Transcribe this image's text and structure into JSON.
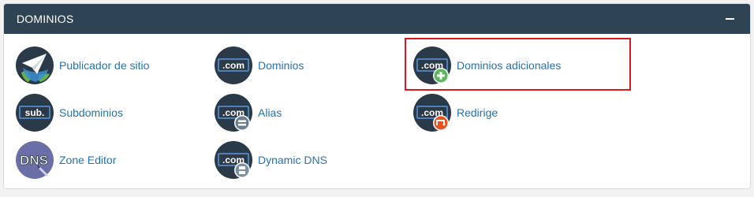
{
  "panel": {
    "title": "DOMINIOS",
    "collapse_icon": "minus-icon"
  },
  "items": [
    {
      "label": "Publicador de sitio",
      "icon": "paper-plane-globe-icon"
    },
    {
      "label": "Dominios",
      "icon": "dotcom-icon",
      "icon_text": ".com"
    },
    {
      "label": "Dominios adicionales",
      "icon": "dotcom-add-icon",
      "icon_text": ".com"
    },
    {
      "label": "Subdominios",
      "icon": "sub-icon",
      "icon_text": "sub."
    },
    {
      "label": "Alias",
      "icon": "dotcom-alias-icon",
      "icon_text": ".com"
    },
    {
      "label": "Redirige",
      "icon": "dotcom-redirect-icon",
      "icon_text": ".com"
    },
    {
      "label": "Zone Editor",
      "icon": "dns-zone-icon",
      "icon_text": "DNS"
    },
    {
      "label": "Dynamic DNS",
      "icon": "dotcom-dynamic-dns-icon",
      "icon_text": ".com"
    }
  ],
  "colors": {
    "header_bg": "#2e4354",
    "link": "#1f73b7",
    "icon_circle": "#2b3a48",
    "highlight": "#d9181e",
    "add_badge": "#5cb85c",
    "redirect_badge": "#e8521f"
  }
}
